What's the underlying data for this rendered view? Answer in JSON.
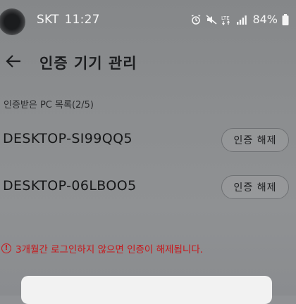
{
  "status_bar": {
    "carrier": "SKT",
    "time": "11:27",
    "battery": "84%",
    "icons": [
      "alarm-icon",
      "mute-icon",
      "lte-icon",
      "signal-icon",
      "battery-icon"
    ]
  },
  "header": {
    "title": "인증 기기 관리",
    "back_icon": "arrow-left-icon"
  },
  "device_list": {
    "header": "인증받은 PC 목록(2/5)",
    "devices": [
      {
        "name": "DESKTOP-SI99QQ5",
        "action": "인증 해제"
      },
      {
        "name": "DESKTOP-06LBOO5",
        "action": "인증 해제"
      }
    ]
  },
  "notice": {
    "icon": "exclamation-circle-icon",
    "symbol": "!",
    "text": "3개월간 로그인하지 않으면 인증이 해제됩니다."
  },
  "colors": {
    "warning": "#c8161a",
    "background": "#8c8e90"
  }
}
